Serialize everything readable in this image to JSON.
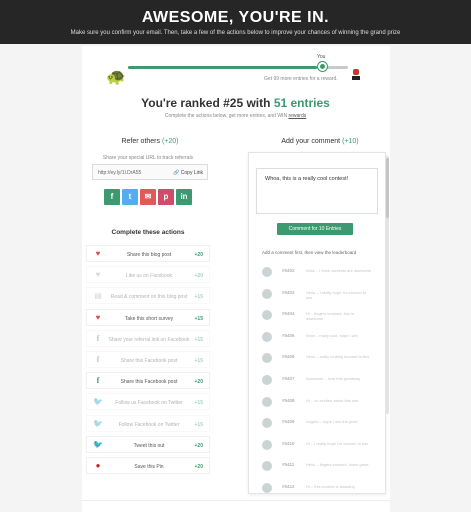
{
  "header": {
    "title": "AWESOME, YOU'RE IN.",
    "subtitle": "Make sure you confirm your email. Then, take a few of the actions below to improve your chances of winning the grand prize"
  },
  "progress": {
    "you_label": "You",
    "reward_text": "Get 99 more entries for a reward.",
    "fill_percent": 86,
    "start_icon": "turtle-icon",
    "prize_icon": "prize-icon"
  },
  "rank": {
    "prefix": "You're ranked #25 with ",
    "highlight": "51 entries",
    "sub_text": "Complete the actions below, get more entries, and WIN ",
    "sub_link": "rewards"
  },
  "refer": {
    "title": "Refer others",
    "points": "(+20)",
    "subtitle": "Share your special URL to track referrals",
    "url": "http://ey.ly/1l.DrA55",
    "copy_label": "Copy Link",
    "share_buttons": [
      {
        "name": "facebook",
        "glyph": "f"
      },
      {
        "name": "twitter",
        "glyph": "t"
      },
      {
        "name": "email",
        "glyph": "✉"
      },
      {
        "name": "pinterest",
        "glyph": "p"
      },
      {
        "name": "linkedin",
        "glyph": "in"
      }
    ]
  },
  "actions": {
    "title": "Complete these actions",
    "items": [
      {
        "label": "Share this blog post",
        "points": "+20",
        "icon": "heart",
        "dim": false
      },
      {
        "label": "Like us on Facebook",
        "points": "+20",
        "icon": "heart-grey",
        "dim": true
      },
      {
        "label": "Read & comment on this blog post",
        "points": "+15",
        "icon": "doc",
        "dim": true
      },
      {
        "label": "Take this short survey",
        "points": "+15",
        "icon": "heart",
        "dim": false
      },
      {
        "label": "Share your referral link on Facebook",
        "points": "+15",
        "icon": "fb",
        "dim": true
      },
      {
        "label": "Share this Facebook post",
        "points": "+15",
        "icon": "fb",
        "dim": true
      },
      {
        "label": "Share this Facebook post",
        "points": "+20",
        "icon": "fb",
        "dim": false
      },
      {
        "label": "Follow us Facebook on Twitter",
        "points": "+15",
        "icon": "tw",
        "dim": true
      },
      {
        "label": "Follow Facebook on Twitter",
        "points": "+15",
        "icon": "tw",
        "dim": true
      },
      {
        "label": "Tweet this out",
        "points": "+20",
        "icon": "tw",
        "dim": false
      },
      {
        "label": "Save this Pin",
        "points": "+20",
        "icon": "pin",
        "dim": false
      }
    ]
  },
  "comments": {
    "title": "Add your comment",
    "points": "(+10)",
    "textarea_value": "Whoa, this is a really cool contest!",
    "button_label": "Comment for 10 Entries",
    "note": "Add a comment first, then view the leaderboard",
    "items": [
      {
        "id": "#5402",
        "text": "Wow – I think contests are awesome"
      },
      {
        "id": "#5403",
        "text": "Hello – I really hope I'm chosen to win"
      },
      {
        "id": "#5404",
        "text": "Hi – fingers crossed, this is awesome"
      },
      {
        "id": "#5405",
        "text": "Wow – really cool, hope I win"
      },
      {
        "id": "#5406",
        "text": "Hello – really looking forward to this"
      },
      {
        "id": "#5407",
        "text": "Awesome – love this giveaway"
      },
      {
        "id": "#5408",
        "text": "Hi – so excited about this one"
      },
      {
        "id": "#5409",
        "text": "Angela – hope I win the prize"
      },
      {
        "id": "#5410",
        "text": "Hi – I really hope I'm chosen to win"
      },
      {
        "id": "#5411",
        "text": "Hello – fingers crossed, looks great"
      },
      {
        "id": "#5412",
        "text": "Hi – this contest is amazing"
      }
    ]
  },
  "colors": {
    "accent": "#3d9970",
    "header_bg": "#262626",
    "twitter": "#55acee",
    "email": "#e05a5a",
    "pinterest": "#d14b6a"
  }
}
